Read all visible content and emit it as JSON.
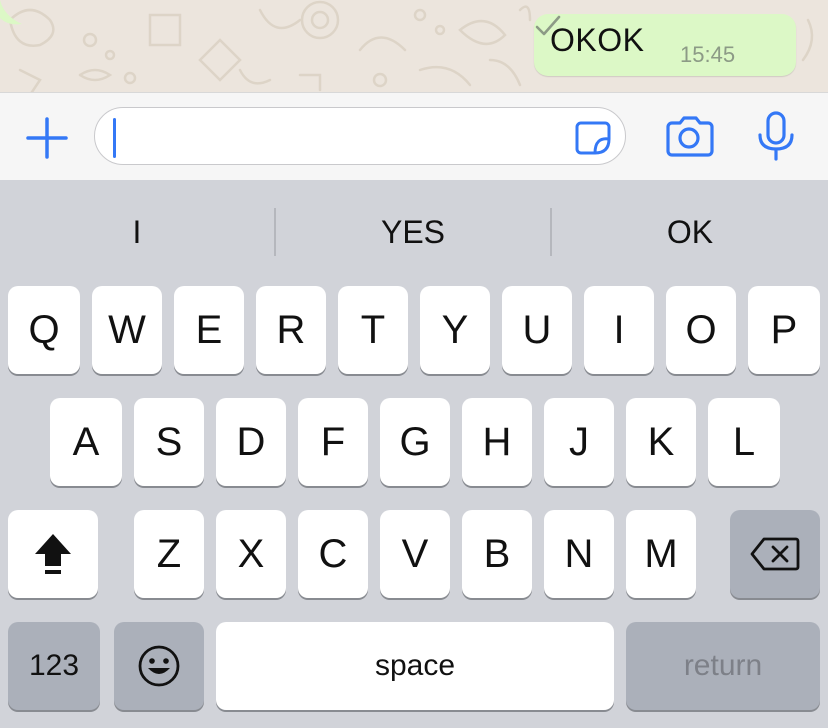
{
  "chat": {
    "message": {
      "text": "OKOK",
      "time": "15:45",
      "status_icon": "single-check-icon"
    },
    "colors": {
      "background": "#ece5dd",
      "bubble": "#dcf8c6"
    }
  },
  "input_bar": {
    "plus_icon": "plus-icon",
    "field_value": "",
    "sticker_icon": "sticker-icon",
    "camera_icon": "camera-icon",
    "mic_icon": "microphone-icon",
    "accent_color": "#3478f6"
  },
  "keyboard": {
    "suggestions": [
      "I",
      "YES",
      "OK"
    ],
    "rows": [
      [
        "Q",
        "W",
        "E",
        "R",
        "T",
        "Y",
        "U",
        "I",
        "O",
        "P"
      ],
      [
        "A",
        "S",
        "D",
        "F",
        "G",
        "H",
        "J",
        "K",
        "L"
      ],
      [
        "Z",
        "X",
        "C",
        "V",
        "B",
        "N",
        "M"
      ]
    ],
    "shift_icon": "shift-icon",
    "delete_icon": "backspace-icon",
    "numbers_label": "123",
    "emoji_icon": "emoji-icon",
    "space_label": "space",
    "return_label": "return"
  }
}
